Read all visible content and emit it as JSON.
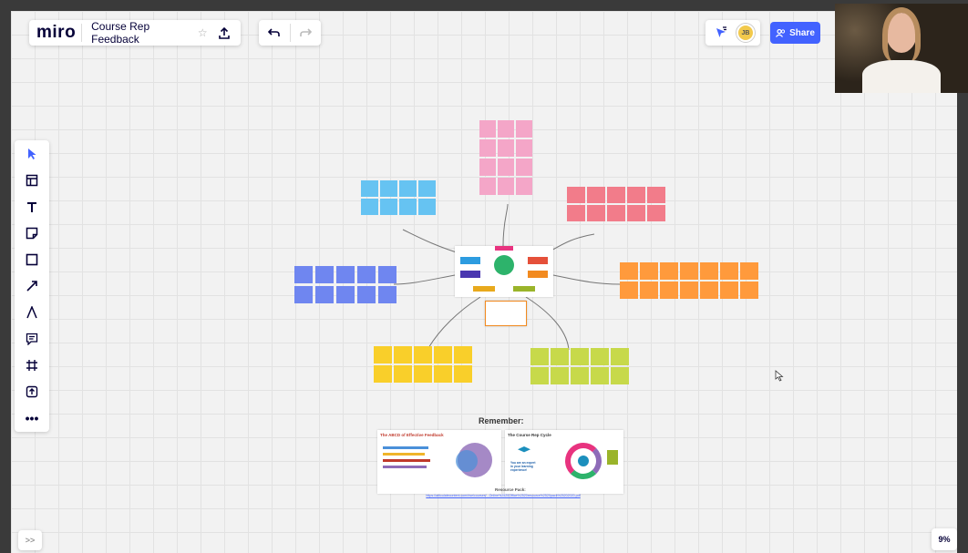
{
  "app": {
    "logo": "miro",
    "board_title": "Course Rep Feedback"
  },
  "toolbar_top": {
    "star_icon": "star-icon",
    "upload_icon": "upload-icon",
    "undo_icon": "undo-icon",
    "redo_icon": "redo-icon"
  },
  "top_right": {
    "share_label": "Share",
    "avatar_initials": "JB"
  },
  "left_tools": [
    "select",
    "templates",
    "text",
    "sticky-note",
    "shape",
    "connection-line",
    "pen",
    "comment",
    "frame",
    "upload",
    "more"
  ],
  "bottom": {
    "expand_label": ">>",
    "zoom_label": "9%"
  },
  "board": {
    "remember_label": "Remember:",
    "card1_title": "The ABCD of Effective Feedback",
    "card2_title": "The Course Rep Cycle",
    "card2_text": "You are an expert in your learning experience!",
    "resource_label": "Resource Pack:",
    "resource_link": "https://articulatecontent.com/rise/courses/...Online%2520Office%2520resource%2520pack%25202020.pdf"
  },
  "colors": {
    "accent": "#4262ff",
    "board": "#f2f2f2",
    "pink": "#f4a6c8",
    "blue": "#66c3f2",
    "red": "#f27c8a",
    "indigo": "#6f86f0",
    "orange": "#ff9a3c",
    "yellow": "#f9cf2a",
    "green": "#c7d94a"
  }
}
